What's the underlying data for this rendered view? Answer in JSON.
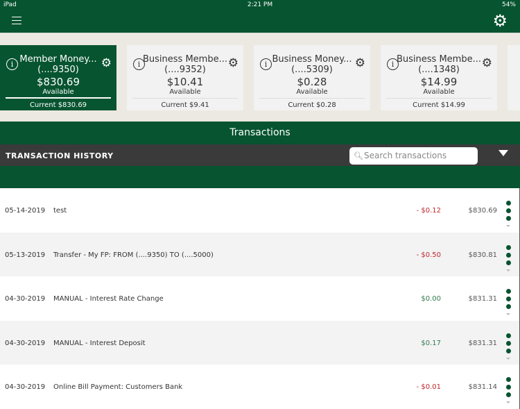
{
  "status": {
    "device": "iPad",
    "time": "2:21 PM",
    "battery": "54%"
  },
  "accounts": [
    {
      "name": "Member Money...",
      "acct": "(....9350)",
      "balance": "$830.69",
      "available": "Available",
      "current": "Current $830.69"
    },
    {
      "name": "Business Membe...",
      "acct": "(....9352)",
      "balance": "$10.41",
      "available": "Available",
      "current": "Current $9.41"
    },
    {
      "name": "Business Money...",
      "acct": "(....5309)",
      "balance": "$0.28",
      "available": "Available",
      "current": "Current $0.28"
    },
    {
      "name": "Business Membe...",
      "acct": "(....1348)",
      "balance": "$14.99",
      "available": "Available",
      "current": "Current $14.99"
    }
  ],
  "title": "Transactions",
  "history_label": "TRANSACTION HISTORY",
  "search_placeholder": "Search transactions",
  "transactions": [
    {
      "date": "05-14-2019",
      "desc": "test",
      "amount": "- $0.12",
      "balance": "$830.69",
      "type": "neg"
    },
    {
      "date": "05-13-2019",
      "desc": "Transfer - My FP: FROM (....9350) TO (....5000)",
      "amount": "- $0.50",
      "balance": "$830.81",
      "type": "neg"
    },
    {
      "date": "04-30-2019",
      "desc": "MANUAL - Interest Rate Change",
      "amount": "$0.00",
      "balance": "$831.31",
      "type": "pos"
    },
    {
      "date": "04-30-2019",
      "desc": "MANUAL - Interest Deposit",
      "amount": "$0.17",
      "balance": "$831.31",
      "type": "pos"
    },
    {
      "date": "04-30-2019",
      "desc": "Online Bill Payment: Customers Bank",
      "amount": "- $0.01",
      "balance": "$831.14",
      "type": "neg"
    }
  ]
}
